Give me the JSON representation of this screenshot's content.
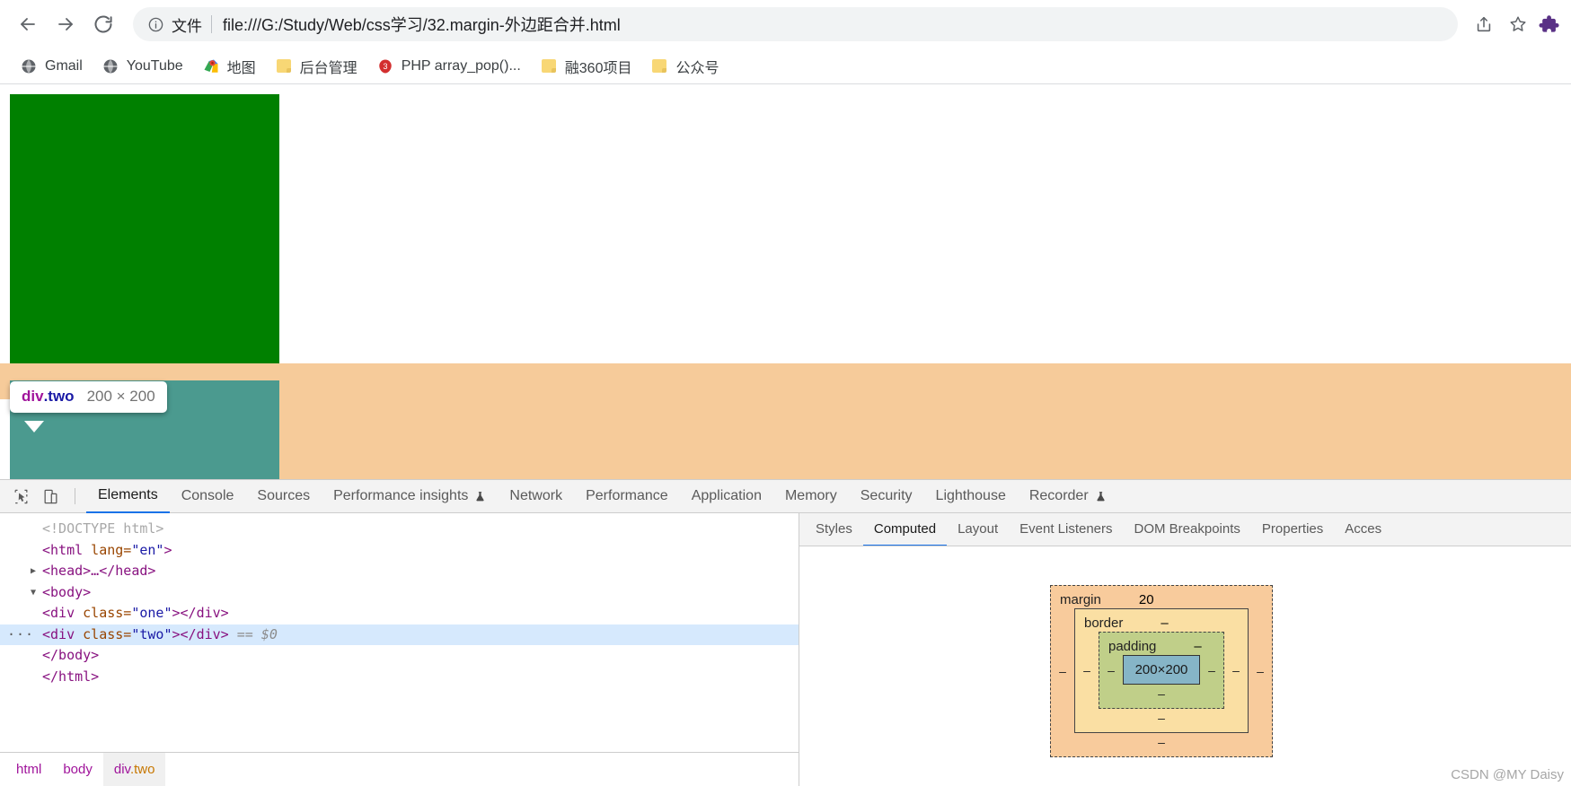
{
  "browser": {
    "nav": {
      "back_label": "Back",
      "forward_label": "Forward",
      "reload_label": "Reload"
    },
    "omnibox": {
      "info_icon": "info-circle-icon",
      "file_label": "文件",
      "url": "file:///G:/Study/Web/css学习/32.margin-外边距合并.html",
      "share_label": "Share",
      "bookmark_star_label": "Bookmark this tab"
    },
    "bookmarks": [
      {
        "label": "Gmail",
        "icon": "globe-icon"
      },
      {
        "label": "YouTube",
        "icon": "globe-icon"
      },
      {
        "label": "地图",
        "icon": "maps-pin-icon"
      },
      {
        "label": "后台管理",
        "icon": "folder-icon"
      },
      {
        "label": "PHP array_pop()...",
        "icon": "php-icon"
      },
      {
        "label": "融360项目",
        "icon": "folder-icon"
      },
      {
        "label": "公众号",
        "icon": "folder-icon"
      }
    ]
  },
  "page": {
    "div_one_color": "#008000",
    "div_two_color": "#4b9a8f",
    "margin_highlight_color": "#f6cb9a",
    "tooltip": {
      "tag": "div",
      "class": ".two",
      "dimensions": "200 × 200"
    }
  },
  "devtools": {
    "toolbar": {
      "inspect_icon": "cursor-select-icon",
      "device_icon": "device-toolbar-icon",
      "tabs": [
        {
          "label": "Elements",
          "active": true,
          "badge": ""
        },
        {
          "label": "Console",
          "active": false,
          "badge": ""
        },
        {
          "label": "Sources",
          "active": false,
          "badge": ""
        },
        {
          "label": "Performance insights",
          "active": false,
          "badge": "flask-icon"
        },
        {
          "label": "Network",
          "active": false,
          "badge": ""
        },
        {
          "label": "Performance",
          "active": false,
          "badge": ""
        },
        {
          "label": "Application",
          "active": false,
          "badge": ""
        },
        {
          "label": "Memory",
          "active": false,
          "badge": ""
        },
        {
          "label": "Security",
          "active": false,
          "badge": ""
        },
        {
          "label": "Lighthouse",
          "active": false,
          "badge": ""
        },
        {
          "label": "Recorder",
          "active": false,
          "badge": "flask-icon"
        }
      ]
    },
    "dom_tree": [
      {
        "indent": 0,
        "doctype": "<!DOCTYPE html>"
      },
      {
        "indent": 0,
        "open": "<html",
        "attr": " lang=",
        "val": "\"en\"",
        "close": ">"
      },
      {
        "indent": 1,
        "twisty": "▶",
        "collapsed": "<head>…</head>"
      },
      {
        "indent": 1,
        "twisty": "▼",
        "open": "<body>"
      },
      {
        "indent": 2,
        "open": "<div",
        "attr": " class=",
        "val": "\"one\"",
        "close": "></div>"
      },
      {
        "indent": 2,
        "open": "<div",
        "attr": " class=",
        "val": "\"two\"",
        "close": "></div>",
        "suffix": " == $0",
        "selected": true
      },
      {
        "indent": 1,
        "open": "</body>"
      },
      {
        "indent": 0,
        "open": "</html>"
      }
    ],
    "breadcrumb": [
      {
        "tag": "html",
        "cls": "",
        "active": false
      },
      {
        "tag": "body",
        "cls": "",
        "active": false
      },
      {
        "tag": "div",
        "cls": ".two",
        "active": true
      }
    ],
    "right_tabs": [
      {
        "label": "Styles",
        "active": false
      },
      {
        "label": "Computed",
        "active": true
      },
      {
        "label": "Layout",
        "active": false
      },
      {
        "label": "Event Listeners",
        "active": false
      },
      {
        "label": "DOM Breakpoints",
        "active": false
      },
      {
        "label": "Properties",
        "active": false
      },
      {
        "label": "Acces",
        "active": false
      }
    ],
    "box_model": {
      "margin_label": "margin",
      "margin_top": "20",
      "margin_left": "–",
      "margin_right": "–",
      "margin_bottom": "–",
      "border_label": "border",
      "border_top": "–",
      "border_left": "–",
      "border_right": "–",
      "border_bottom": "–",
      "padding_label": "padding",
      "padding_top": "–",
      "padding_left": "–",
      "padding_right": "–",
      "padding_bottom": "–",
      "content": "200×200",
      "colors": {
        "margin": "#f8cb9c",
        "border": "#fadfa3",
        "padding": "#c0cf89",
        "content": "#86b5c7"
      }
    },
    "watermark": "CSDN @MY Daisy"
  }
}
